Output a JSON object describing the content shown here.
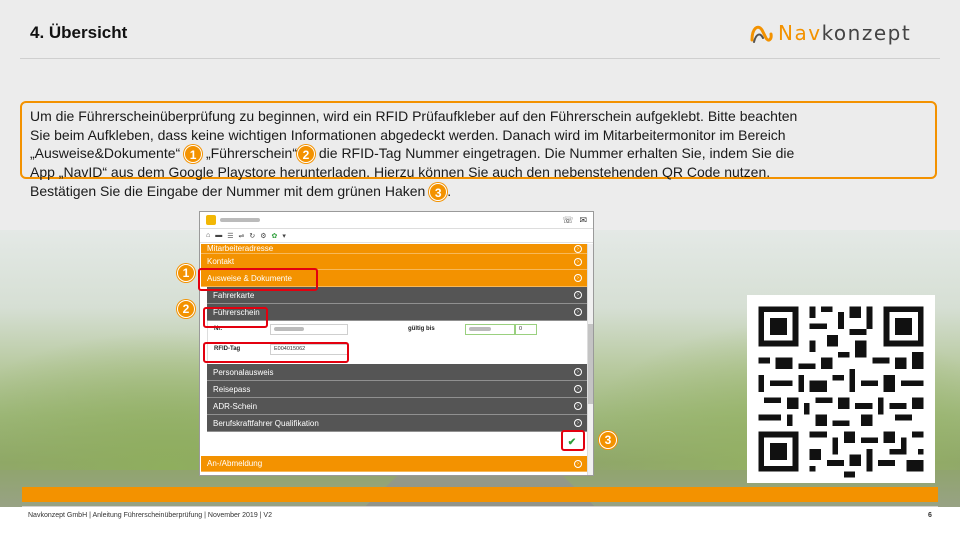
{
  "slide": {
    "title": "4. Übersicht",
    "logo": {
      "part_nav": "Nav",
      "part_konzept": "konzept",
      "brand_color": "#f39200"
    }
  },
  "intro": {
    "line1": "Um die Führerscheinüberprüfung zu beginnen, wird ein RFID Prüfaufkleber auf den Führerschein aufgeklebt. Bitte beachten",
    "line2": "Sie beim Aufkleben, dass keine wichtigen Informationen abgedeckt werden. Danach wird im Mitarbeitermonitor im Bereich",
    "line3_a": "„Ausweise&Dokumente“",
    "badge1": "1",
    "line3_b": " „Führerschein“",
    "badge2": "2",
    "line3_c": " die RFID-Tag Nummer eingetragen. Die Nummer erhalten Sie, indem Sie die",
    "line4": "App „NavID“ aus dem Google Playstore herunterladen. Hierzu können Sie auch den nebenstehenden QR Code nutzen.",
    "line5": "Bestätigen Sie die Eingabe der Nummer mit dem grünen Haken",
    "badge3": "3",
    "line5_end": "."
  },
  "screenshot": {
    "rows_top": [
      {
        "label": "Mitarbeiteradresse"
      },
      {
        "label": "Kontakt"
      },
      {
        "label": "Ausweise & Dokumente"
      }
    ],
    "rows_sub": [
      {
        "label": "Fahrerkarte"
      },
      {
        "label": "Führerschein"
      }
    ],
    "form": {
      "nr_label": "Nr.",
      "gueltig_label": "gültig bis",
      "gueltig_extra": "0",
      "rfid_label": "RFID-Tag",
      "rfid_value": "E004015062"
    },
    "rows_bottom": [
      {
        "label": "Personalausweis"
      },
      {
        "label": "Reisepass"
      },
      {
        "label": "ADR-Schein"
      },
      {
        "label": "Berufskraftfahrer Qualifikation"
      }
    ],
    "row_last": {
      "label": "An-/Abmeldung"
    },
    "check_icon": "✔"
  },
  "callouts": {
    "c1": "1",
    "c2": "2",
    "c3": "3"
  },
  "footer": {
    "text": "Navkonzept GmbH  |  Anleitung Führerscheinüberprüfung  |  November 2019  |  V2",
    "page": "6"
  }
}
